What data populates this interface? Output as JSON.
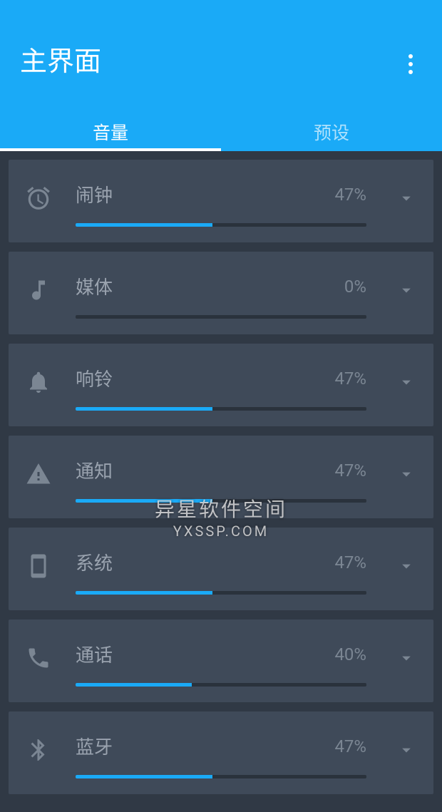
{
  "header": {
    "title": "主界面"
  },
  "tabs": {
    "volume": "音量",
    "preset": "预设"
  },
  "items": [
    {
      "icon": "alarm",
      "label": "闹钟",
      "pct": "47%",
      "value": 47
    },
    {
      "icon": "music",
      "label": "媒体",
      "pct": "0%",
      "value": 0
    },
    {
      "icon": "bell",
      "label": "响铃",
      "pct": "47%",
      "value": 47
    },
    {
      "icon": "alert",
      "label": "通知",
      "pct": "47%",
      "value": 47
    },
    {
      "icon": "phone-device",
      "label": "系统",
      "pct": "47%",
      "value": 47
    },
    {
      "icon": "call",
      "label": "通话",
      "pct": "40%",
      "value": 40
    },
    {
      "icon": "bluetooth",
      "label": "蓝牙",
      "pct": "47%",
      "value": 47
    }
  ],
  "watermark": {
    "line1": "异星软件空间",
    "line2": "YXSSP.COM"
  },
  "colors": {
    "accent": "#1aaaf7",
    "card": "#3f4a59",
    "bg": "#303945"
  }
}
